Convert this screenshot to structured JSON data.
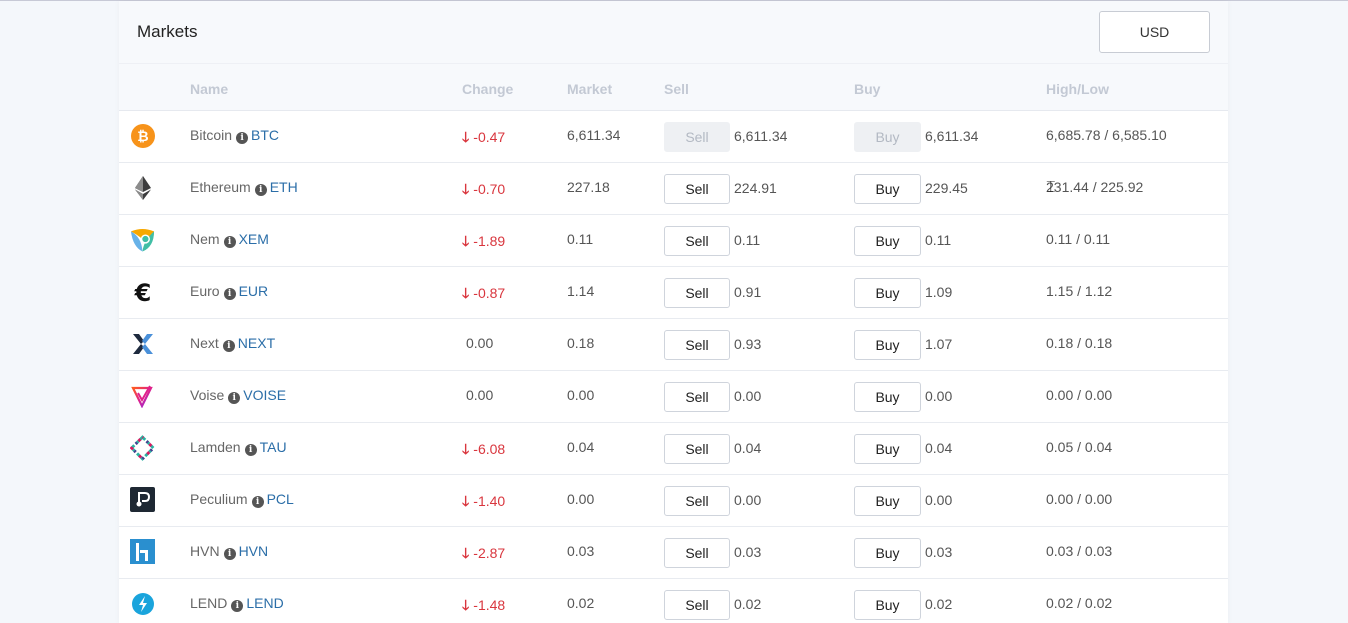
{
  "header": {
    "title": "Markets",
    "currency_label": "USD"
  },
  "columns": {
    "name": "Name",
    "change": "Change",
    "market": "Market",
    "sell": "Sell",
    "buy": "Buy",
    "highlow": "High/Low"
  },
  "buttons": {
    "sell": "Sell",
    "buy": "Buy"
  },
  "change_arrow": "🡓",
  "info_glyph": "i",
  "colors": {
    "negative": "#d9363e",
    "symbol_link": "#2b6ea8"
  },
  "rows": [
    {
      "name": "Bitcoin",
      "symbol": "BTC",
      "change": "-0.47",
      "market": "6,611.34",
      "sell": "6,611.34",
      "buy": "6,611.34",
      "highlow": "6,685.78 / 6,585.10",
      "icon": "bitcoin-icon",
      "trade_disabled": true
    },
    {
      "name": "Ethereum",
      "symbol": "ETH",
      "change": "-0.70",
      "market": "227.18",
      "sell": "224.91",
      "buy": "229.45",
      "highlow": "231.44 / 225.92",
      "icon": "ethereum-icon"
    },
    {
      "name": "Nem",
      "symbol": "XEM",
      "change": "-1.89",
      "market": "0.11",
      "sell": "0.11",
      "buy": "0.11",
      "highlow": "0.11 / 0.11",
      "icon": "nem-icon"
    },
    {
      "name": "Euro",
      "symbol": "EUR",
      "change": "-0.87",
      "market": "1.14",
      "sell": "0.91",
      "buy": "1.09",
      "highlow": "1.15 / 1.12",
      "icon": "euro-icon"
    },
    {
      "name": "Next",
      "symbol": "NEXT",
      "change": "0.00",
      "market": "0.18",
      "sell": "0.93",
      "buy": "1.07",
      "highlow": "0.18 / 0.18",
      "icon": "next-icon"
    },
    {
      "name": "Voise",
      "symbol": "VOISE",
      "change": "0.00",
      "market": "0.00",
      "sell": "0.00",
      "buy": "0.00",
      "highlow": "0.00 / 0.00",
      "icon": "voise-icon"
    },
    {
      "name": "Lamden",
      "symbol": "TAU",
      "change": "-6.08",
      "market": "0.04",
      "sell": "0.04",
      "buy": "0.04",
      "highlow": "0.05 / 0.04",
      "icon": "lamden-icon"
    },
    {
      "name": "Peculium",
      "symbol": "PCL",
      "change": "-1.40",
      "market": "0.00",
      "sell": "0.00",
      "buy": "0.00",
      "highlow": "0.00 / 0.00",
      "icon": "peculium-icon"
    },
    {
      "name": "HVN",
      "symbol": "HVN",
      "change": "-2.87",
      "market": "0.03",
      "sell": "0.03",
      "buy": "0.03",
      "highlow": "0.03 / 0.03",
      "icon": "hvn-icon"
    },
    {
      "name": "LEND",
      "symbol": "LEND",
      "change": "-1.48",
      "market": "0.02",
      "sell": "0.02",
      "buy": "0.02",
      "highlow": "0.02 / 0.02",
      "icon": "lend-icon"
    }
  ]
}
